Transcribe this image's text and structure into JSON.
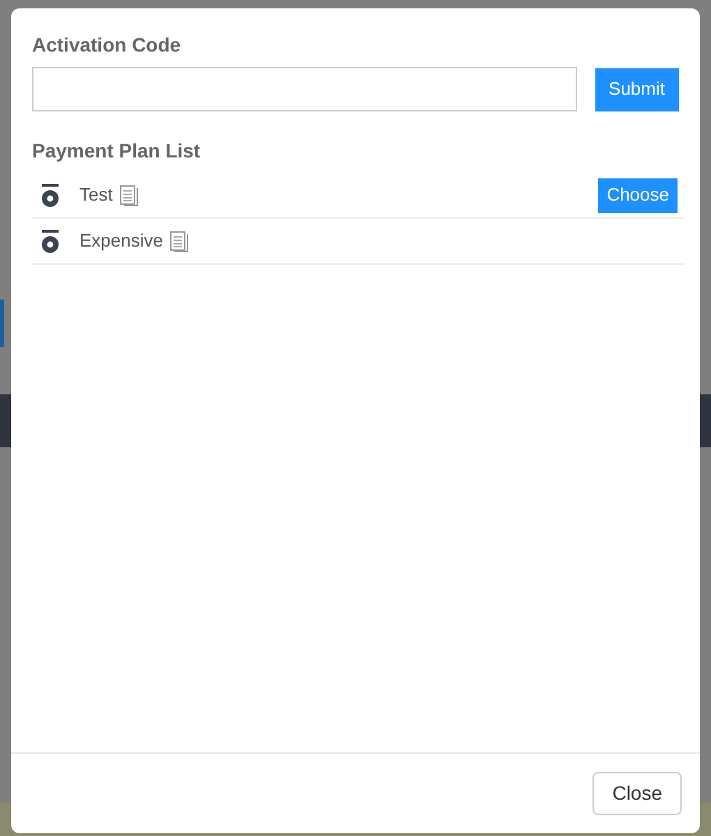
{
  "activation": {
    "label": "Activation Code",
    "submit": "Submit"
  },
  "plans": {
    "title": "Payment Plan List",
    "items": [
      {
        "name": "Test",
        "action": "Choose"
      },
      {
        "name": "Expensive"
      }
    ]
  },
  "footer": {
    "close": "Close"
  }
}
